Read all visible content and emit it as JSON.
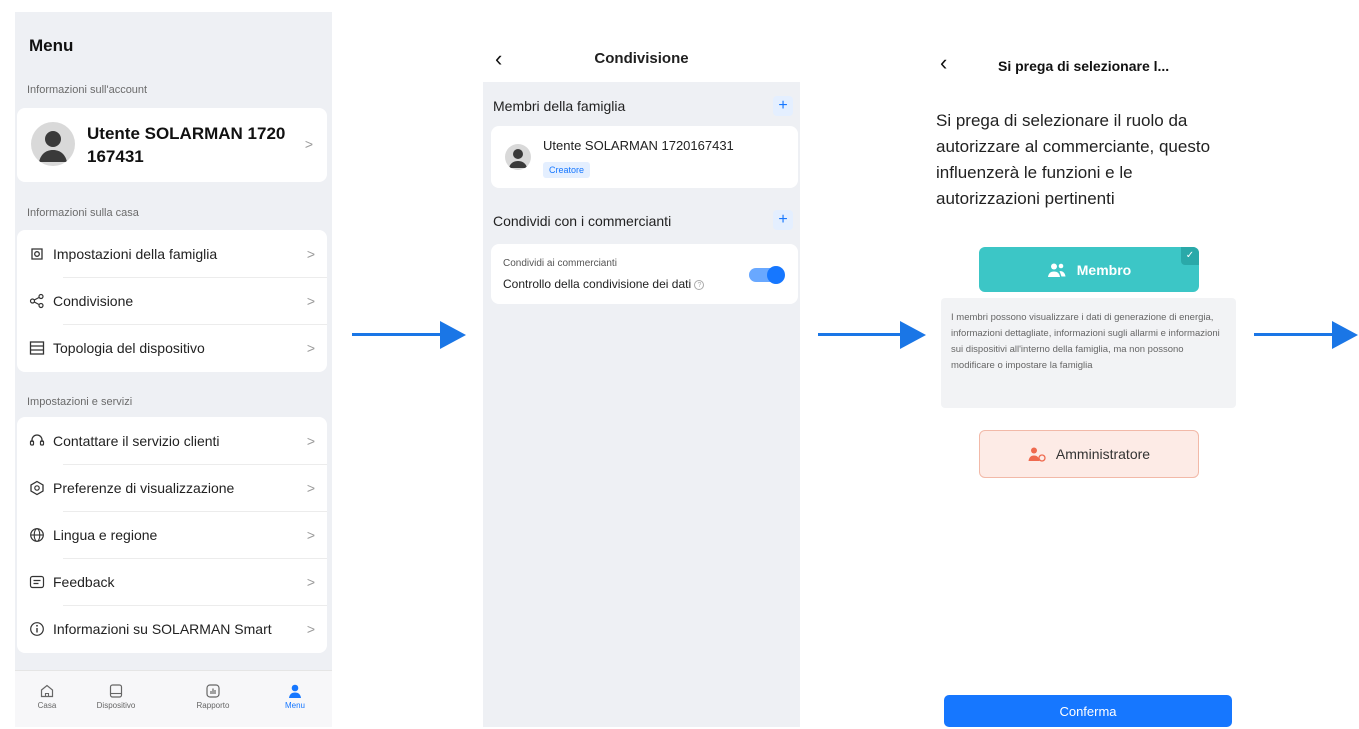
{
  "menu": {
    "title": "Menu",
    "account_section": "Informazioni sull'account",
    "user_name": "Utente SOLARMAN 1720 167431",
    "home_section": "Informazioni sulla casa",
    "home_items": [
      {
        "label": "Impostazioni della famiglia",
        "icon": "family-settings-icon"
      },
      {
        "label": "Condivisione",
        "icon": "share-icon"
      },
      {
        "label": "Topologia del dispositivo",
        "icon": "topology-icon"
      }
    ],
    "services_section": "Impostazioni e servizi",
    "service_items": [
      {
        "label": "Contattare il servizio clienti",
        "icon": "headset-icon"
      },
      {
        "label": "Preferenze di visualizzazione",
        "icon": "display-icon"
      },
      {
        "label": "Lingua e regione",
        "icon": "globe-icon"
      },
      {
        "label": "Feedback",
        "icon": "feedback-icon"
      },
      {
        "label": "Informazioni su SOLARMAN Smart",
        "icon": "info-icon"
      }
    ],
    "tabs": [
      {
        "label": "Casa",
        "icon": "home-icon"
      },
      {
        "label": "Dispositivo",
        "icon": "device-icon"
      },
      {
        "label": "Rapporto",
        "icon": "report-icon"
      },
      {
        "label": "Menu",
        "icon": "user-icon"
      }
    ]
  },
  "share": {
    "title": "Condivisione",
    "family_section": "Membri della famiglia",
    "member_name": "Utente SOLARMAN 1720167431",
    "member_badge": "Creatore",
    "merchants_section": "Condividi con i commercianti",
    "toggle_caption": "Condividi ai commercianti",
    "toggle_label": "Controllo della condivisione dei dati",
    "toggle_on": true
  },
  "role": {
    "title": "Si prega di selezionare l...",
    "instruction": "Si prega di selezionare il ruolo da autorizzare al commerciante, questo influenzerà le funzioni e le autorizzazioni pertinenti",
    "member_label": "Membro",
    "member_description": "I membri possono visualizzare i dati di generazione di energia, informazioni dettagliate, informazioni sugli allarmi e informazioni sui dispositivi all'interno della famiglia, ma non possono modificare o impostare la famiglia",
    "admin_label": "Amministratore",
    "confirm_label": "Conferma"
  },
  "colors": {
    "accent": "#1677ff",
    "member_teal": "#3cc6c6",
    "admin_bg": "#fdebe6",
    "admin_icon": "#ef6a4f",
    "arrow": "#1a76e6"
  }
}
